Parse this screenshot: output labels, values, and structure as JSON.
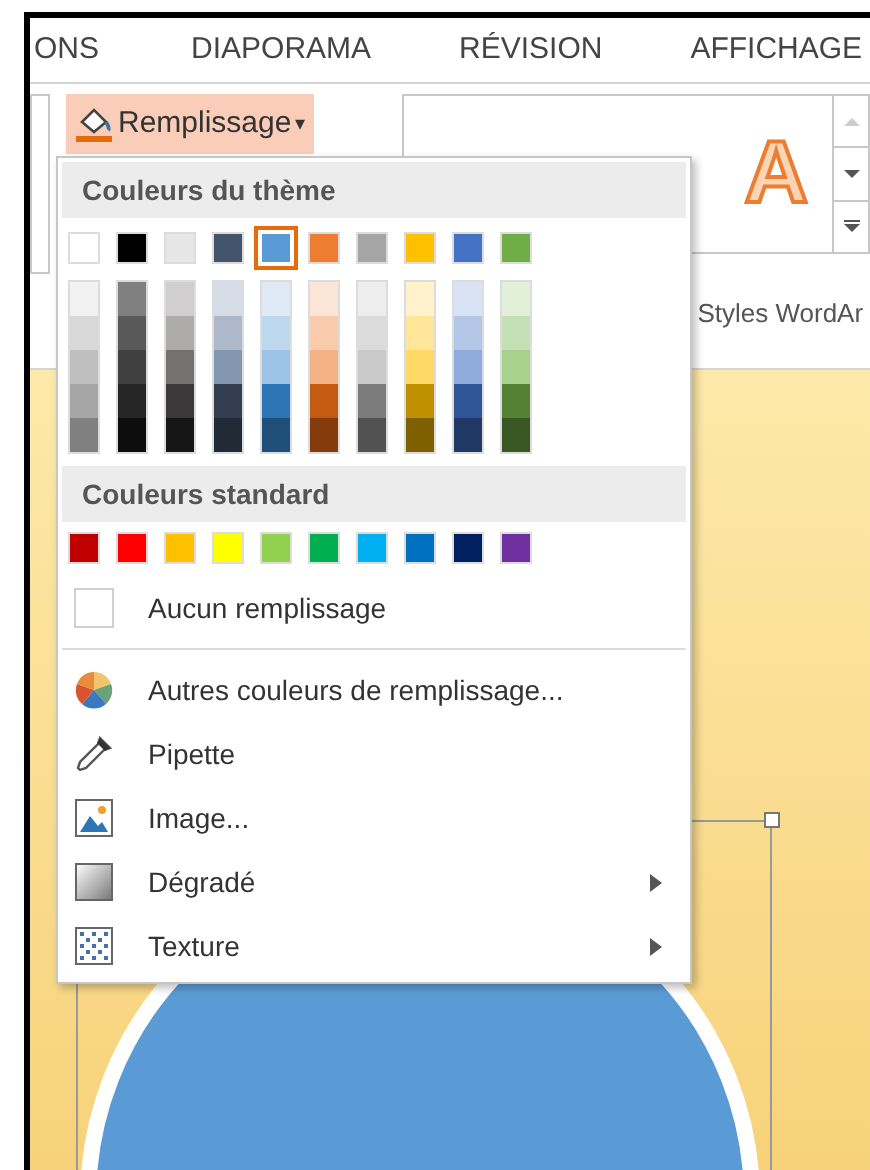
{
  "ribbon_tabs": [
    {
      "label": "ONS",
      "selected": false
    },
    {
      "label": "DIAPORAMA",
      "selected": false
    },
    {
      "label": "RÉVISION",
      "selected": false
    },
    {
      "label": "AFFICHAGE",
      "selected": false
    }
  ],
  "fill_button": {
    "label": "Remplissage",
    "caret": "▾",
    "open": true
  },
  "wordart_gallery": {
    "preview": "A",
    "group_label": "Styles WordAr"
  },
  "menu": {
    "theme_header": "Couleurs du thème",
    "theme_colors": [
      {
        "color": "#ffffff",
        "selected": false
      },
      {
        "color": "#000000",
        "selected": false
      },
      {
        "color": "#e7e6e6",
        "selected": false
      },
      {
        "color": "#44546a",
        "selected": false
      },
      {
        "color": "#5b9bd5",
        "selected": true
      },
      {
        "color": "#ed7d31",
        "selected": false
      },
      {
        "color": "#a5a5a5",
        "selected": false
      },
      {
        "color": "#ffc000",
        "selected": false
      },
      {
        "color": "#4472c4",
        "selected": false
      },
      {
        "color": "#70ad47",
        "selected": false
      }
    ],
    "theme_shades": [
      {
        "shades": [
          {
            "color": "#f2f2f2"
          },
          {
            "color": "#d9d9d9"
          },
          {
            "color": "#bfbfbf"
          },
          {
            "color": "#a6a6a6"
          },
          {
            "color": "#808080"
          }
        ]
      },
      {
        "shades": [
          {
            "color": "#808080"
          },
          {
            "color": "#595959"
          },
          {
            "color": "#404040"
          },
          {
            "color": "#262626"
          },
          {
            "color": "#0d0d0d"
          }
        ]
      },
      {
        "shades": [
          {
            "color": "#d0cece"
          },
          {
            "color": "#aeabab"
          },
          {
            "color": "#767171"
          },
          {
            "color": "#3a3838"
          },
          {
            "color": "#171616"
          }
        ]
      },
      {
        "shades": [
          {
            "color": "#d6dce5"
          },
          {
            "color": "#adb9ca"
          },
          {
            "color": "#8497b0"
          },
          {
            "color": "#333f50"
          },
          {
            "color": "#222a35"
          }
        ]
      },
      {
        "shades": [
          {
            "color": "#deebf7"
          },
          {
            "color": "#bdd7ee"
          },
          {
            "color": "#9dc3e6"
          },
          {
            "color": "#2e75b6"
          },
          {
            "color": "#1f4e79"
          }
        ]
      },
      {
        "shades": [
          {
            "color": "#fbe5d6"
          },
          {
            "color": "#f8cbad"
          },
          {
            "color": "#f4b183"
          },
          {
            "color": "#c55a11"
          },
          {
            "color": "#843c0c"
          }
        ]
      },
      {
        "shades": [
          {
            "color": "#ededed"
          },
          {
            "color": "#dbdbdb"
          },
          {
            "color": "#c9c9c9"
          },
          {
            "color": "#7b7b7b"
          },
          {
            "color": "#525252"
          }
        ]
      },
      {
        "shades": [
          {
            "color": "#fff2cc"
          },
          {
            "color": "#ffe699"
          },
          {
            "color": "#ffd966"
          },
          {
            "color": "#bf9000"
          },
          {
            "color": "#7f6000"
          }
        ]
      },
      {
        "shades": [
          {
            "color": "#dae3f3"
          },
          {
            "color": "#b4c7e7"
          },
          {
            "color": "#8faadc"
          },
          {
            "color": "#2f5597"
          },
          {
            "color": "#1f3864"
          }
        ]
      },
      {
        "shades": [
          {
            "color": "#e2f0d9"
          },
          {
            "color": "#c5e0b4"
          },
          {
            "color": "#a9d18e"
          },
          {
            "color": "#548235"
          },
          {
            "color": "#385723"
          }
        ]
      }
    ],
    "standard_header": "Couleurs standard",
    "standard_colors": [
      {
        "color": "#c00000"
      },
      {
        "color": "#ff0000"
      },
      {
        "color": "#ffc000"
      },
      {
        "color": "#ffff00"
      },
      {
        "color": "#92d050"
      },
      {
        "color": "#00b050"
      },
      {
        "color": "#00b0f0"
      },
      {
        "color": "#0070c0"
      },
      {
        "color": "#002060"
      },
      {
        "color": "#7030a0"
      }
    ],
    "items": [
      {
        "kind": "none",
        "label": "Aucun remplissage",
        "has_submenu": false
      },
      {
        "kind": "palette",
        "label": "Autres couleurs de remplissage...",
        "has_submenu": false
      },
      {
        "kind": "eyedropper",
        "label": "Pipette",
        "has_submenu": false
      },
      {
        "kind": "picture",
        "label": "Image...",
        "has_submenu": false
      },
      {
        "kind": "gradient",
        "label": "Dégradé",
        "has_submenu": true
      },
      {
        "kind": "texture",
        "label": "Texture",
        "has_submenu": true
      }
    ]
  }
}
